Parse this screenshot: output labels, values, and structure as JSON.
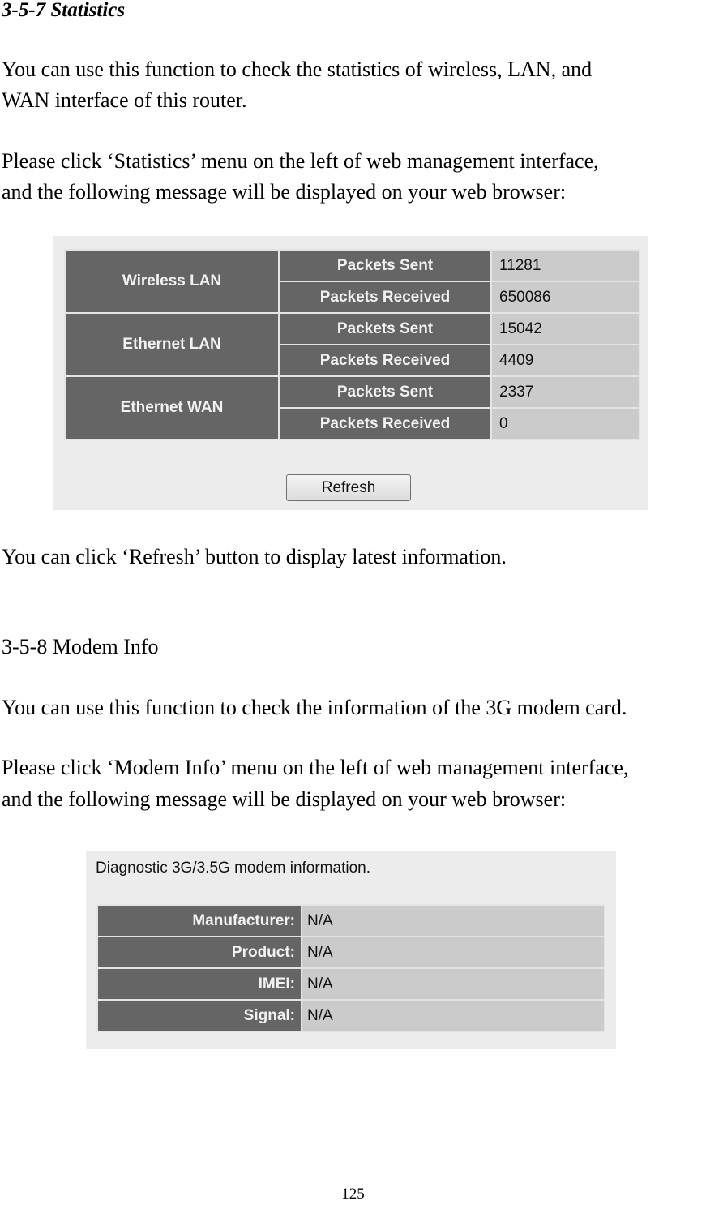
{
  "section_statistics": {
    "heading": "3-5-7 Statistics",
    "para1_line1": "You can use this function to check the statistics of wireless, LAN, and",
    "para1_line2": "WAN interface of this router.",
    "para2_line1": "Please click ‘Statistics’ menu on the left of web management interface,",
    "para2_line2": "and the following message will be displayed on your web browser:",
    "after_text": "You can click ‘Refresh’ button to display latest information."
  },
  "stats_panel": {
    "rows": [
      {
        "interface": "Wireless LAN",
        "metrics": [
          {
            "label": "Packets Sent",
            "value": "11281"
          },
          {
            "label": "Packets Received",
            "value": "650086"
          }
        ]
      },
      {
        "interface": "Ethernet LAN",
        "metrics": [
          {
            "label": "Packets Sent",
            "value": "15042"
          },
          {
            "label": "Packets Received",
            "value": "4409"
          }
        ]
      },
      {
        "interface": "Ethernet WAN",
        "metrics": [
          {
            "label": "Packets Sent",
            "value": "2337"
          },
          {
            "label": "Packets Received",
            "value": "0"
          }
        ]
      }
    ],
    "refresh_label": "Refresh"
  },
  "section_modem": {
    "heading": "3-5-8 Modem Info",
    "para1": "You can use this function to check the information of the 3G modem card.",
    "para2_line1": "Please click ‘Modem Info’ menu on the left of web management interface,",
    "para2_line2": "and the following message will be displayed on your web browser:"
  },
  "modem_panel": {
    "caption": "Diagnostic 3G/3.5G modem information.",
    "rows": [
      {
        "label": "Manufacturer:",
        "value": "N/A"
      },
      {
        "label": "Product:",
        "value": "N/A"
      },
      {
        "label": "IMEI:",
        "value": "N/A"
      },
      {
        "label": "Signal:",
        "value": "N/A"
      }
    ]
  },
  "page_number": "125"
}
